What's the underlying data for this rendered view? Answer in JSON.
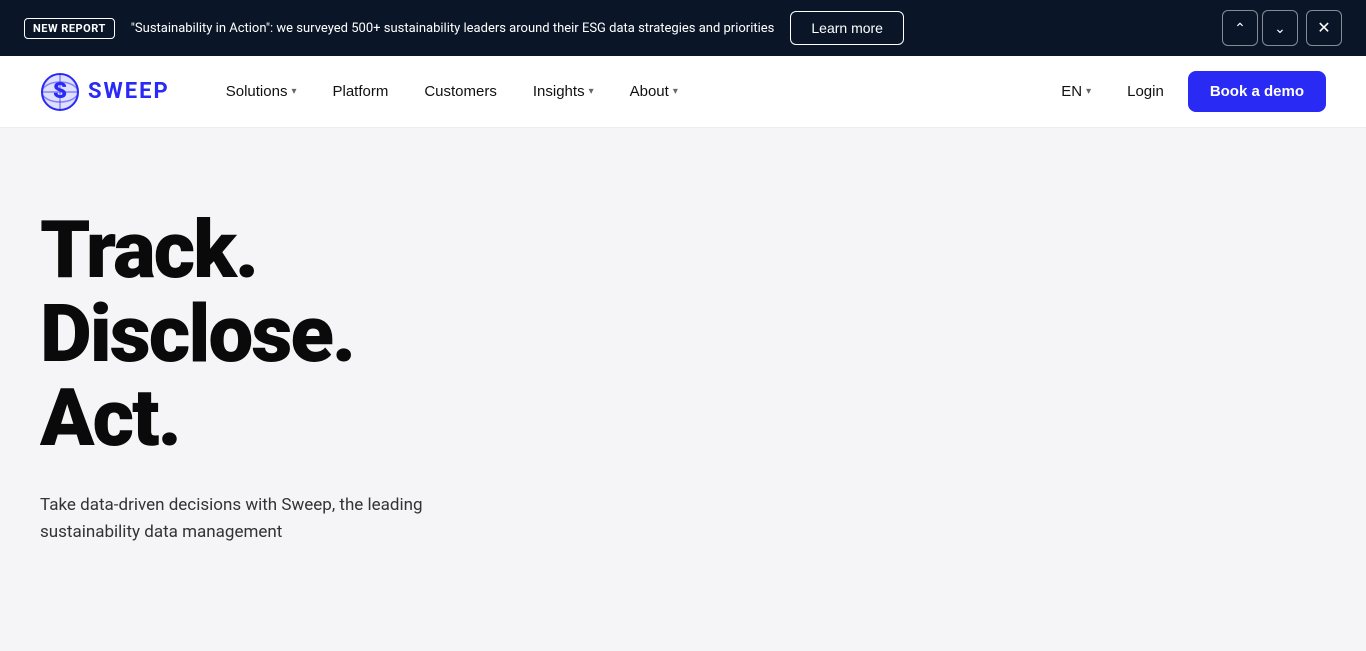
{
  "announcement": {
    "badge": "NEW REPORT",
    "text": "\"Sustainability in Action\": we surveyed 500+ sustainability leaders around their ESG data strategies and priorities",
    "learn_more_label": "Learn more",
    "prev_label": "‹",
    "next_label": "›",
    "close_label": "✕"
  },
  "navbar": {
    "logo_text": "SWEEP",
    "nav_items": [
      {
        "label": "Solutions",
        "has_dropdown": true
      },
      {
        "label": "Platform",
        "has_dropdown": false
      },
      {
        "label": "Customers",
        "has_dropdown": false
      },
      {
        "label": "Insights",
        "has_dropdown": true
      },
      {
        "label": "About",
        "has_dropdown": true
      }
    ],
    "lang_label": "EN",
    "login_label": "Login",
    "book_demo_label": "Book a demo"
  },
  "hero": {
    "line1": "Track.",
    "line2": "Disclose.",
    "line3": "Act.",
    "subtext": "Take data-driven decisions with Sweep, the leading sustainability data management"
  }
}
